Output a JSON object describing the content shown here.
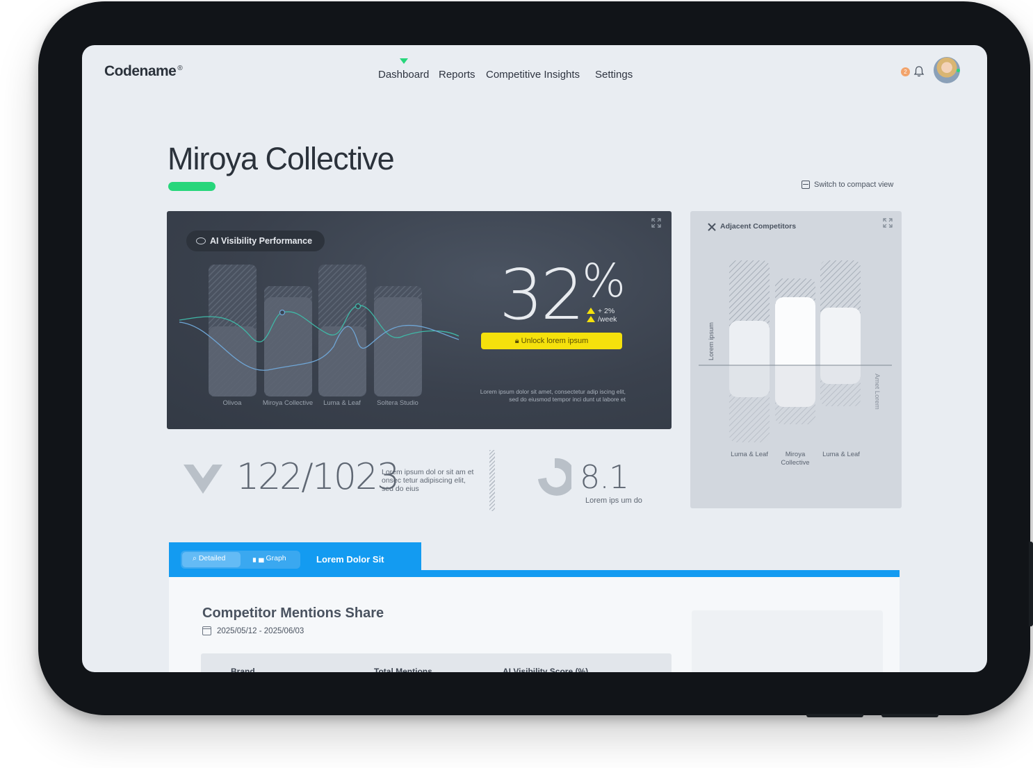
{
  "brand": {
    "name": "Codename",
    "mark": "®"
  },
  "nav": {
    "items": [
      "Dashboard",
      "Reports",
      "Competitive Insights",
      "Settings"
    ],
    "active": "Dashboard"
  },
  "notifications": {
    "count": "2"
  },
  "page": {
    "title": "Miroya Collective",
    "compact_label": "Switch to compact view"
  },
  "visibility_card": {
    "title": "AI Visibility Performance",
    "value": "32",
    "value_unit": "%",
    "delta_1": "+ 2%",
    "delta_2": "/week",
    "unlock_label": "Unlock lorem ipsum",
    "description": "Lorem ipsum dolor sit amet, consectetur adip iscing elit, sed do eiusmod tempor inci dunt ut labore et",
    "bars": [
      "Olivoa",
      "Miroya Collective",
      "Luma & Leaf",
      "Soltera Studio"
    ]
  },
  "competitors_card": {
    "title": "Adjacent Competitors",
    "y_left": "Lorem ipsum",
    "y_right": "Amet Lorem",
    "bars": [
      "Luma & Leaf",
      "Miroya\nCollective",
      "Luma & Leaf"
    ]
  },
  "stats": {
    "ratio": "122/1023",
    "ratio_desc": "Lorem ipsum dol or sit am et onsec tetur adipiscing elit, sed do eius",
    "score": "8.1",
    "score_desc": "Lorem ips um do"
  },
  "tabs": {
    "detailed": "Detailed",
    "graph": "Graph",
    "title": "Lorem Dolor Sit"
  },
  "panel": {
    "title": "Competitor Mentions Share",
    "date_range": "2025/05/12 - 2025/06/03",
    "columns": [
      "Brand",
      "Total Mentions",
      "AI Visibility Score (%)"
    ]
  },
  "colors": {
    "accent_green": "#27d67b",
    "accent_blue": "#139bf1",
    "accent_yellow": "#f5e10c"
  }
}
